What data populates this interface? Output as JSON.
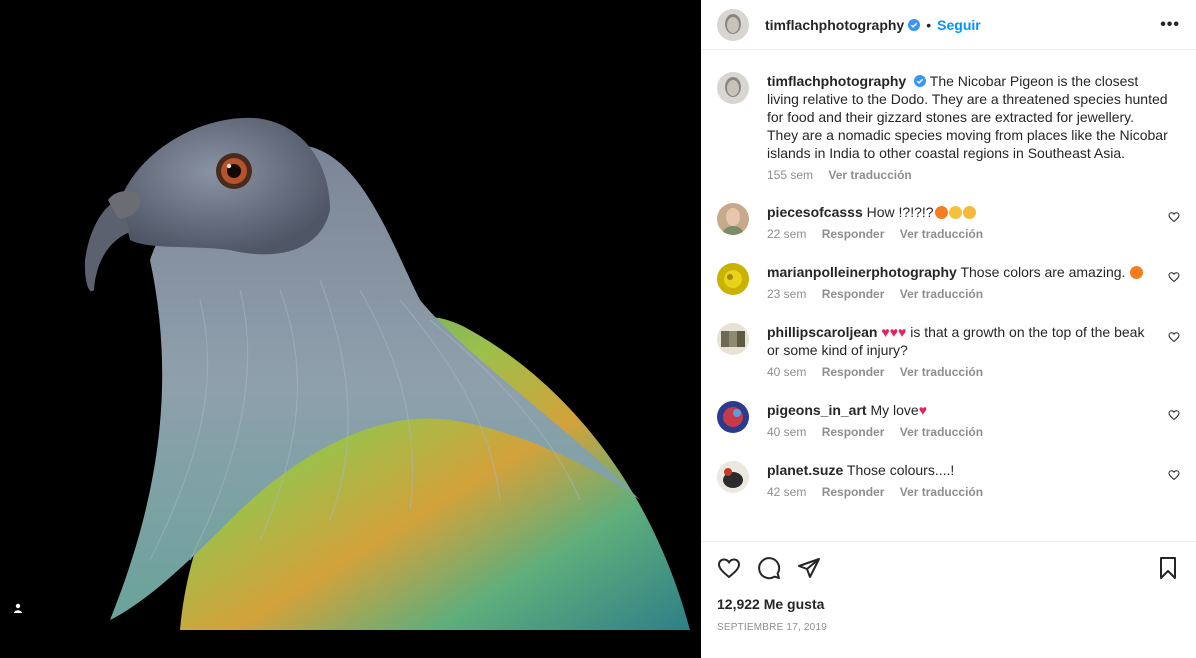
{
  "post": {
    "username": "timflachphotography",
    "verified_icon": "verified-badge-icon",
    "separator": "•",
    "follow_label": "Seguir",
    "more_icon": "more-options-icon",
    "more_label": "•••"
  },
  "caption": {
    "username": "timflachphotography",
    "text": "The Nicobar Pigeon is the closest living relative to the Dodo. They are a threatened species hunted for food and their gizzard stones are extracted for jewellery. They are a nomadic species moving from places like the Nicobar islands in India to other coastal regions in Southeast Asia.",
    "time": "155 sem",
    "translate_label": "Ver traducción"
  },
  "comments": [
    {
      "username": "piecesofcasss",
      "text": "How !?!?!?",
      "emojis": [
        "fire",
        "clap",
        "star-eyes"
      ],
      "time": "22 sem",
      "reply_label": "Responder",
      "translate_label": "Ver traducción"
    },
    {
      "username": "marianpolleinerphotography",
      "text": "Those colors are amazing.",
      "emojis": [
        "fire"
      ],
      "time": "23 sem",
      "reply_label": "Responder",
      "translate_label": "Ver traducción"
    },
    {
      "username": "phillipscaroljean",
      "text": "is that a growth on the top of the beak or some kind of injury?",
      "emojis_before": [
        "heart",
        "heart",
        "heart"
      ],
      "time": "40 sem",
      "reply_label": "Responder",
      "translate_label": "Ver traducción"
    },
    {
      "username": "pigeons_in_art",
      "text": "My love",
      "emojis": [
        "heart"
      ],
      "time": "40 sem",
      "reply_label": "Responder",
      "translate_label": "Ver traducción"
    },
    {
      "username": "planet.suze",
      "text": "Those colours....!",
      "time": "42 sem",
      "reply_label": "Responder",
      "translate_label": "Ver traducción"
    }
  ],
  "action_icons": [
    "like-icon",
    "comment-icon",
    "share-icon",
    "save-icon"
  ],
  "likes": "12,922 Me gusta",
  "date": "SEPTIEMBRE 17, 2019",
  "colors": {
    "accent": "#0095f6",
    "text": "#262626",
    "muted": "#8e8e8e",
    "heart": "#ed4956"
  }
}
